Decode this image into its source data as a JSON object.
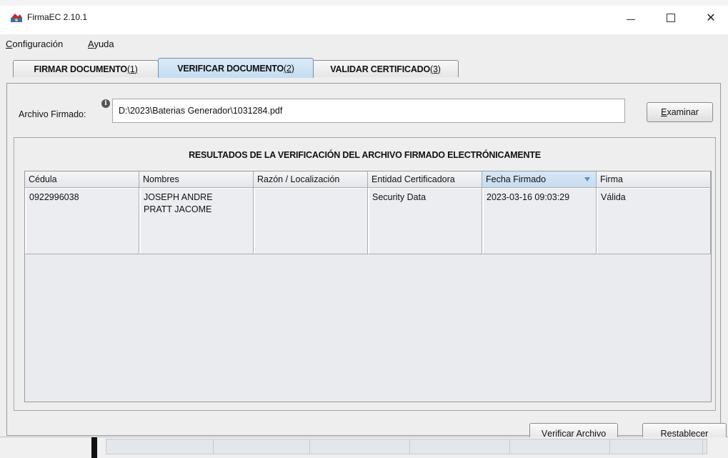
{
  "window": {
    "title": "FirmaEC 2.10.1"
  },
  "menubar": {
    "items": [
      {
        "mnemonic": "C",
        "rest": "onfiguración"
      },
      {
        "mnemonic": "A",
        "rest": "yuda"
      }
    ]
  },
  "tabs": [
    {
      "label": "FIRMAR DOCUMENTO ",
      "hotkey": "(1)",
      "active": false
    },
    {
      "label": "VERIFICAR DOCUMENTO ",
      "hotkey": "(2)",
      "active": true
    },
    {
      "label": "VALIDAR CERTIFICADO ",
      "hotkey": "(3)",
      "active": false
    }
  ],
  "file": {
    "label": "Archivo Firmado:",
    "value": "D:\\2023\\Baterias Generador\\1031284.pdf",
    "browse_mnemonic": "E",
    "browse_rest": "xaminar"
  },
  "results": {
    "title": "RESULTADOS DE LA VERIFICACIÓN DEL ARCHIVO FIRMADO ELECTRÓNICAMENTE",
    "columns": [
      "Cédula",
      "Nombres",
      "Razón / Localización",
      "Entidad Certificadora",
      "Fecha Firmado",
      "Firma"
    ],
    "sorted_column": "Fecha Firmado",
    "rows": [
      {
        "cedula": "0922996038",
        "nombres_line1": "JOSEPH ANDRE",
        "nombres_line2": "PRATT JACOME",
        "razon": "",
        "entidad": "Security Data",
        "fecha": "2023-03-16 09:03:29",
        "firma": "Válida"
      }
    ]
  },
  "actions": {
    "verify_mnemonic": "V",
    "verify_rest": "erificar Archivo",
    "reset_mnemonic": "R",
    "reset_rest": "establecer"
  },
  "colors": {
    "active_tab": "#c3dcf1",
    "sort_indicator": "#5c8fc4",
    "window_bg": "#eeeeee"
  }
}
